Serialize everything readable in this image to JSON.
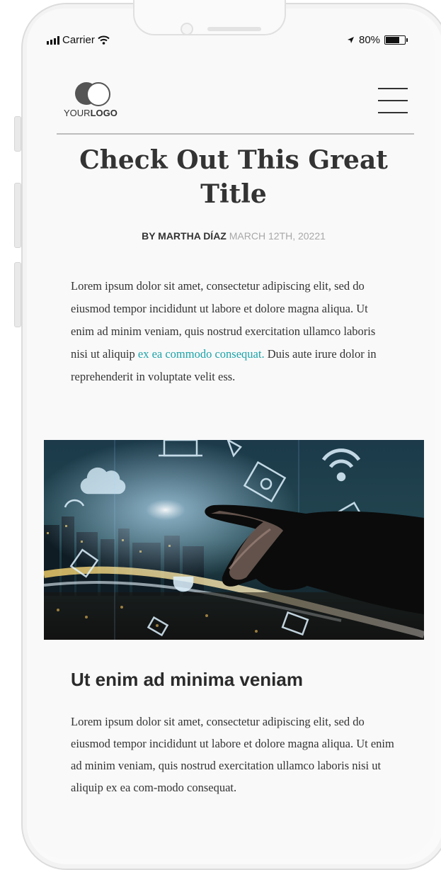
{
  "status_bar": {
    "carrier": "Carrier",
    "battery_text": "80%",
    "battery_level": 0.8,
    "signal_icon": "signal-bars-icon",
    "wifi_icon": "wifi-icon",
    "location_icon": "location-arrow-icon"
  },
  "header": {
    "logo_regular": "YOUR",
    "logo_bold": "LOGO",
    "menu_icon": "hamburger-menu-icon"
  },
  "article": {
    "title": "Check Out This Great Title",
    "author": "BY MARTHA DÍAZ",
    "date": "MARCH 12TH, 20221",
    "intro_before_link": "Lorem ipsum dolor sit amet, consectetur adipiscing elit, sed do eiusmod tempor incididunt ut labore et dolore magna aliqua. Ut enim ad minim veniam, quis nostrud exercitation ullamco laboris nisi ut aliquip ",
    "intro_link": "ex ea commodo consequat.",
    "intro_after_link": " Duis aute irure dolor in reprehenderit in voluptate velit ess.",
    "subheading": "Ut enim ad minima veniam",
    "section_body": "Lorem ipsum dolor sit amet, consectetur adipiscing elit, sed do eiusmod tempor incididunt ut labore et dolore magna aliqua. Ut enim ad minim veniam, quis nostrud exercitation ullamco laboris nisi ut aliquip ex ea com-modo consequat."
  },
  "colors": {
    "link": "#1ba3a9",
    "heading": "#333333",
    "date": "#a8a8a8"
  }
}
